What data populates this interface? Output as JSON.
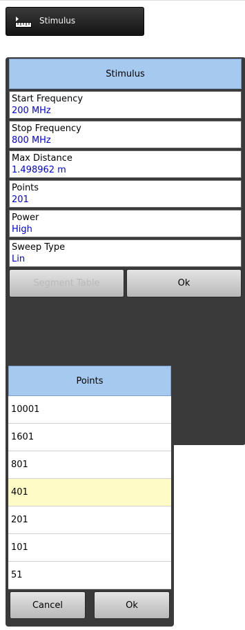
{
  "toolbar": {
    "label": "Stimulus",
    "icon": "ruler-icon"
  },
  "stimulus_panel": {
    "title": "Stimulus",
    "fields": [
      {
        "name": "Start Frequency",
        "value": "200 MHz"
      },
      {
        "name": "Stop Frequency",
        "value": "800 MHz"
      },
      {
        "name": "Max Distance",
        "value": "1.498962 m"
      },
      {
        "name": "Points",
        "value": "201"
      },
      {
        "name": "Power",
        "value": "High"
      },
      {
        "name": "Sweep Type",
        "value": "Lin"
      }
    ],
    "segment_table_label": "Segment Table",
    "ok_label": "Ok"
  },
  "points_panel": {
    "title": "Points",
    "options": [
      "10001",
      "1601",
      "801",
      "401",
      "201",
      "101",
      "51"
    ],
    "selected": "401",
    "cancel_label": "Cancel",
    "ok_label": "Ok"
  },
  "colors": {
    "header": "#a5c9ef",
    "value_text": "#0000dd",
    "selected_row": "#fffbc6"
  }
}
